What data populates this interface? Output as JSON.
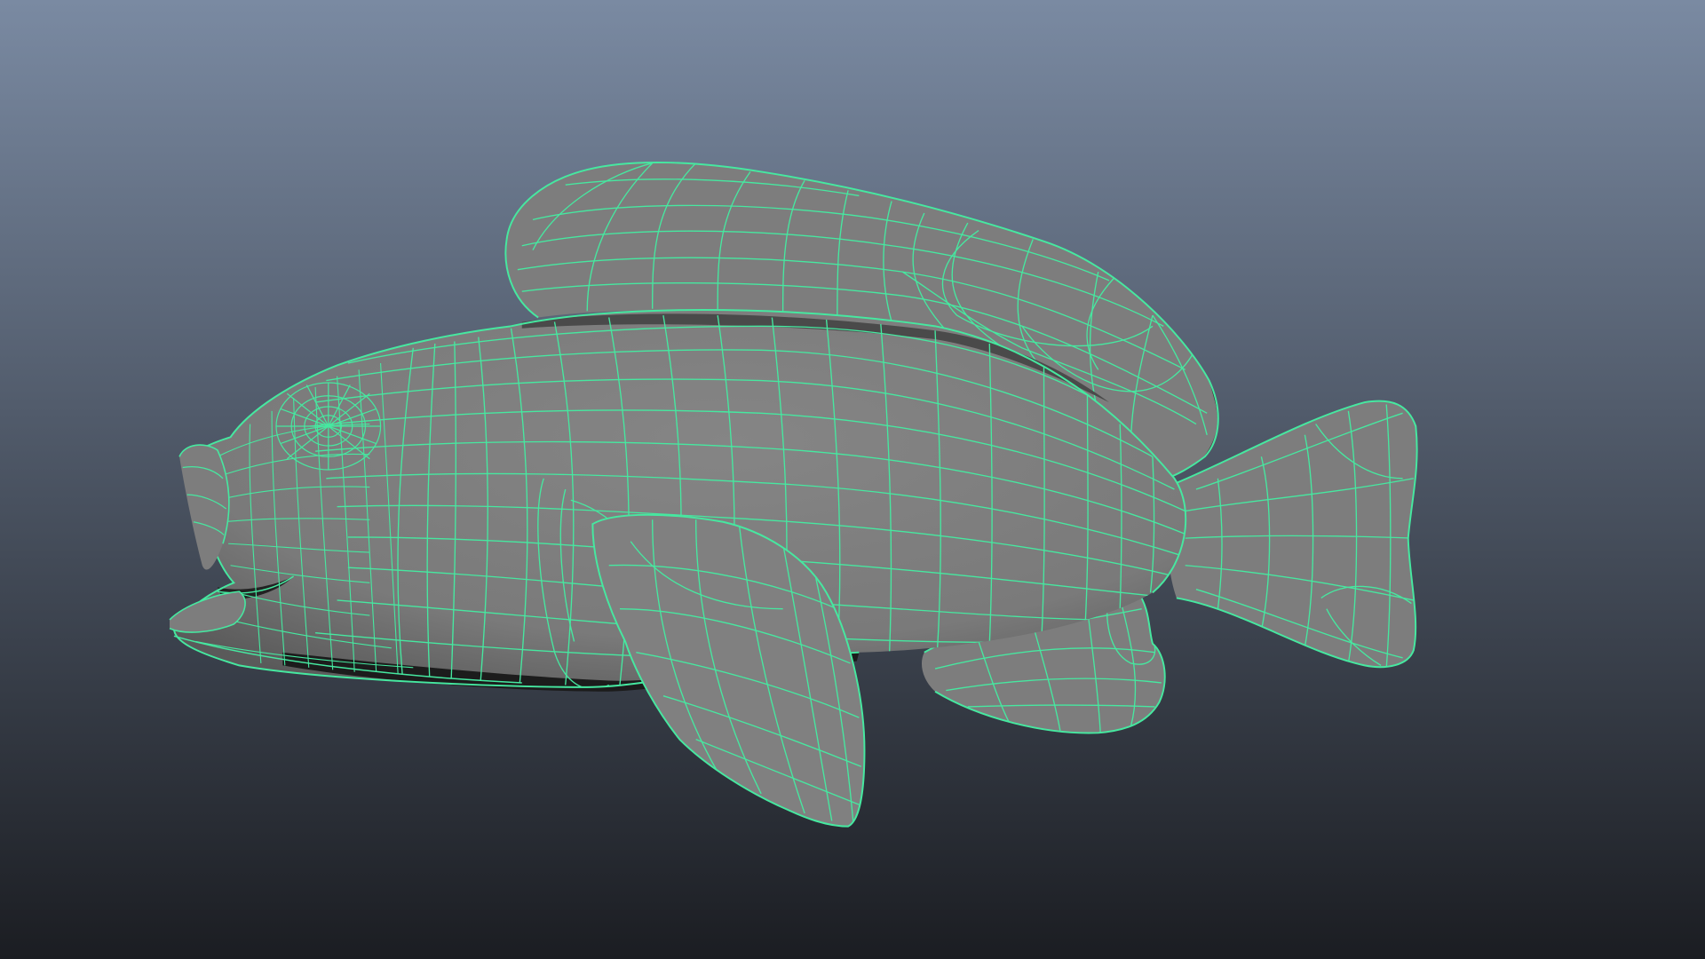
{
  "viewport": {
    "background_top": "#7a8aa2",
    "background_bottom": "#1b1d22"
  },
  "model": {
    "shade_color": "#7d7d7d",
    "shadow_color": "#2b2b2b",
    "wireframe_color": "#46e8a0"
  }
}
